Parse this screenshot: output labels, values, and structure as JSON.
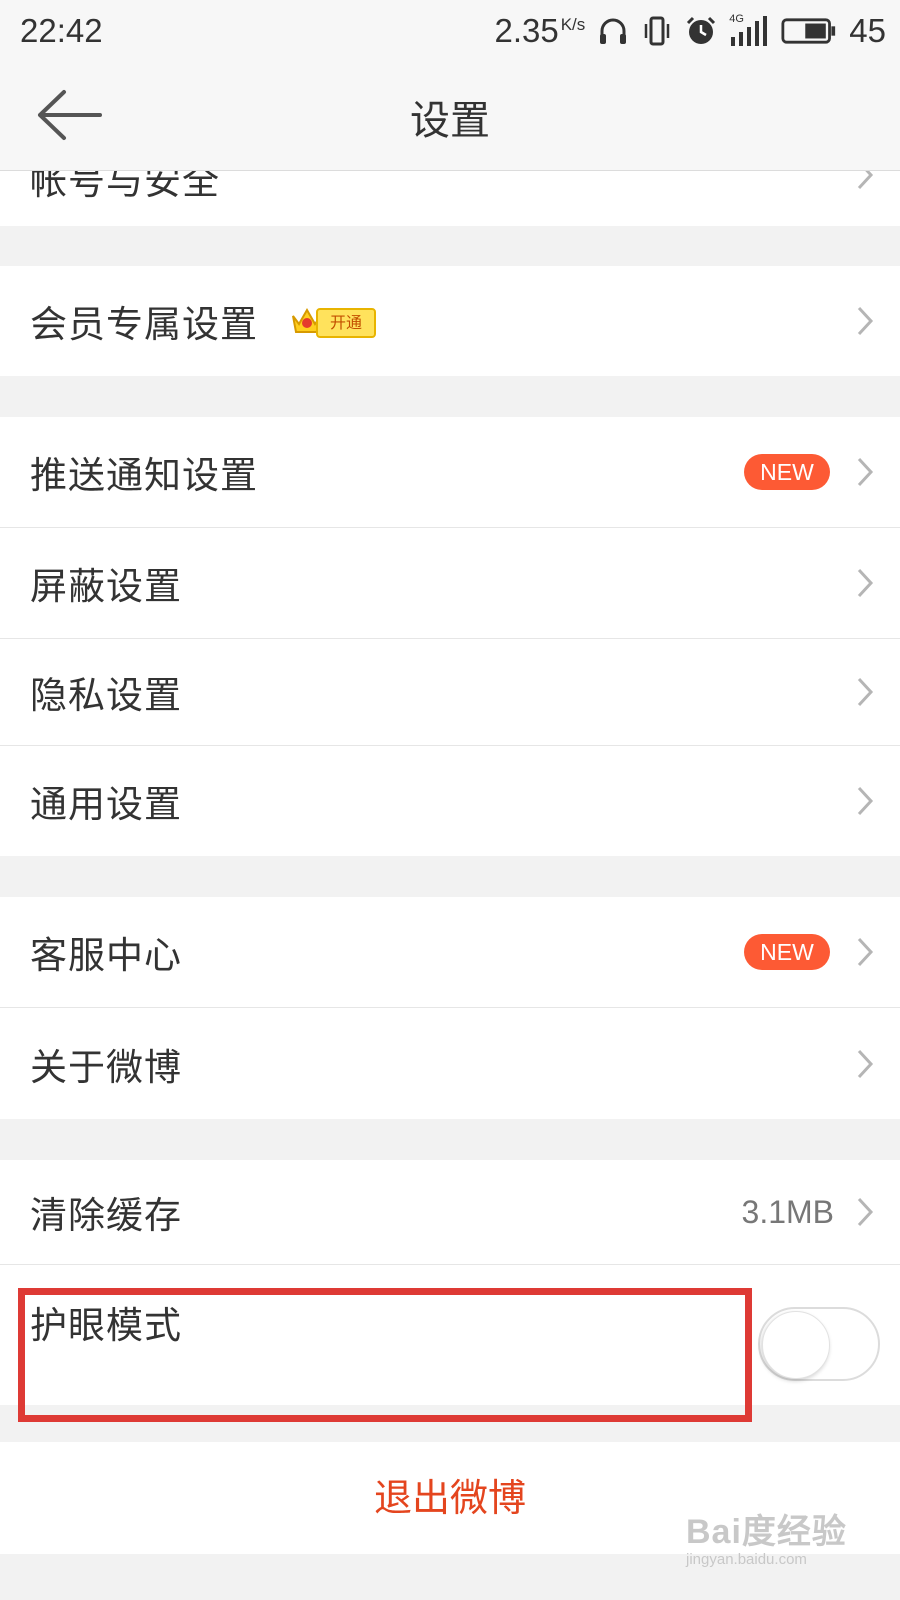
{
  "status_bar": {
    "time": "22:42",
    "speed": "2.35",
    "speed_unit": "K/s",
    "network": "4G",
    "battery": "45",
    "icons": [
      "headphones-icon",
      "vibrate-icon",
      "alarm-icon",
      "signal-icon",
      "battery-icon"
    ]
  },
  "nav": {
    "back_icon": "arrow-left-icon",
    "title": "设置"
  },
  "sections": [
    {
      "items": [
        {
          "id": "account",
          "label": "帐号与安全"
        }
      ]
    },
    {
      "items": [
        {
          "id": "vip",
          "label": "会员专属设置",
          "vip_badge": "开通"
        }
      ]
    },
    {
      "items": [
        {
          "id": "push",
          "label": "推送通知设置",
          "badge": "NEW"
        },
        {
          "id": "block",
          "label": "屏蔽设置"
        },
        {
          "id": "privacy",
          "label": "隐私设置"
        },
        {
          "id": "general",
          "label": "通用设置"
        }
      ]
    },
    {
      "items": [
        {
          "id": "service",
          "label": "客服中心",
          "badge": "NEW"
        },
        {
          "id": "about",
          "label": "关于微博"
        }
      ]
    },
    {
      "items": [
        {
          "id": "cache",
          "label": "清除缓存",
          "value": "3.1MB"
        },
        {
          "id": "eye",
          "label": "护眼模式",
          "toggle": false
        }
      ]
    }
  ],
  "logout": "退出微博",
  "watermark": {
    "main": "Bai度经验",
    "sub": "jingyan.baidu.com"
  },
  "colors": {
    "accent": "#e4451e",
    "badge": "#fd5a34",
    "highlight": "#de3a35",
    "page_bg": "#f2f2f2"
  }
}
